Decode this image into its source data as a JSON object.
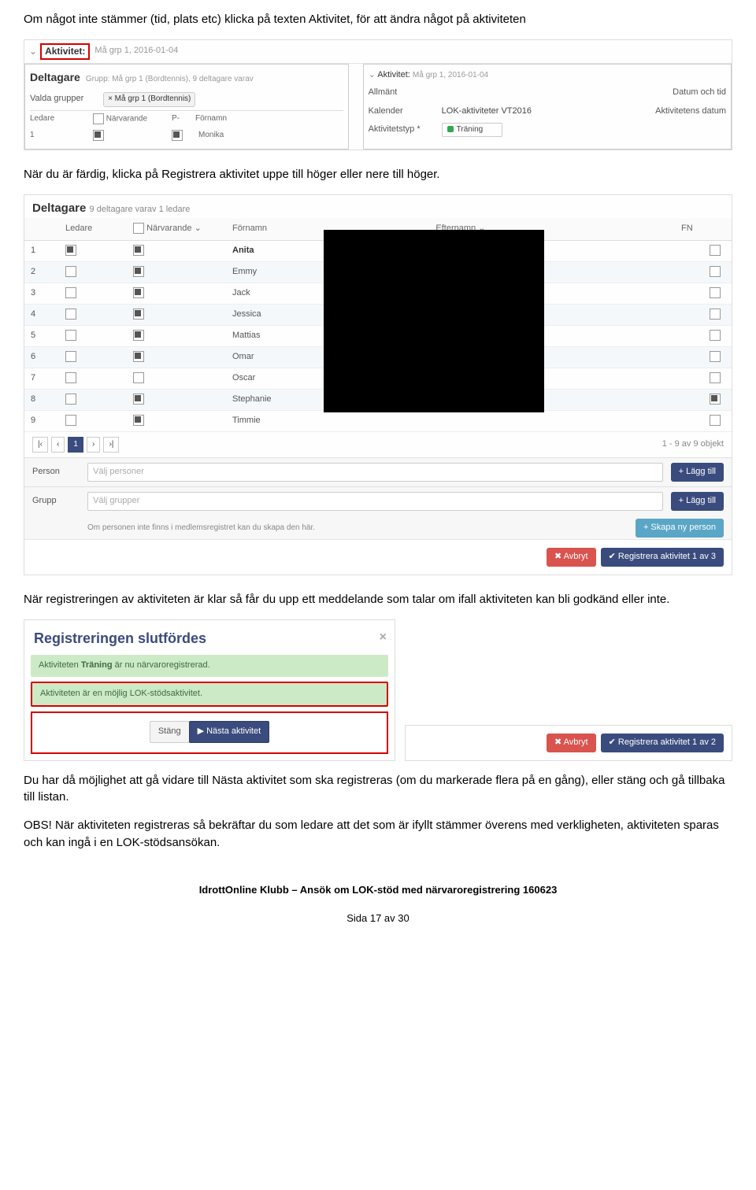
{
  "para1": "Om något inte stämmer (tid, plats etc) klicka på texten Aktivitet, för att ändra något på aktiviteten",
  "para2": "När du är färdig, klicka på Registrera aktivitet uppe till höger eller nere till höger.",
  "para3": "När registreringen av aktiviteten är klar så får du upp ett meddelande som talar om ifall aktiviteten kan bli godkänd eller inte.",
  "para4": "Du har då möjlighet att gå vidare till Nästa aktivitet som ska registreras (om du markerade flera på en gång), eller stäng och gå tillbaka till listan.",
  "para5": "OBS! När aktiviteten registreras så bekräftar du som ledare att det som är ifyllt stämmer överens med verkligheten, aktiviteten sparas och kan ingå i en LOK-stödsansökan.",
  "footer_line": "IdrottOnline Klubb – Ansök om LOK-stöd med närvaroregistrering 160623",
  "page_num": "Sida 17 av 30",
  "s1": {
    "aktivitet_label": "Aktivitet:",
    "aktivitet_sub": "Må grp 1, 2016-01-04",
    "deltagare_title": "Deltagare",
    "deltagare_group": "Grupp: Må grp 1 (Bordtennis), 9 deltagare varav",
    "valda_grupper": "Valda grupper",
    "grupp_tag": "× Må grp 1 (Bordtennis)",
    "th_ledare": "Ledare",
    "th_narv": "Närvarande",
    "th_p": "P-",
    "th_fornamn": "Förnamn",
    "row1_num": "1",
    "row1_name": "Monika",
    "right_aktivitet_label": "Aktivitet:",
    "right_aktivitet_sub": "Må grp 1, 2016-01-04",
    "allmant": "Allmänt",
    "datum_tid": "Datum och tid",
    "kalender_lbl": "Kalender",
    "kalender_val": "LOK-aktiviteter VT2016",
    "akttyp_lbl": "Aktivitetstyp *",
    "akttyp_val": "Träning",
    "aktdat_lbl": "Aktivitetens datum"
  },
  "s2": {
    "title": "Deltagare",
    "subtitle": "9 deltagare varav 1 ledare",
    "cols": {
      "ledare": "Ledare",
      "narv": "Närvarande",
      "fn": "Förnamn",
      "en": "Efternamn",
      "fncol": "FN"
    },
    "rows": [
      {
        "n": "1",
        "led": true,
        "nar": true,
        "name": "Anita",
        "fn": false,
        "even": false
      },
      {
        "n": "2",
        "led": false,
        "nar": true,
        "name": "Emmy",
        "fn": false,
        "even": true
      },
      {
        "n": "3",
        "led": false,
        "nar": true,
        "name": "Jack",
        "fn": false,
        "even": false
      },
      {
        "n": "4",
        "led": false,
        "nar": true,
        "name": "Jessica",
        "fn": false,
        "even": true
      },
      {
        "n": "5",
        "led": false,
        "nar": true,
        "name": "Mattias",
        "fn": false,
        "even": false
      },
      {
        "n": "6",
        "led": false,
        "nar": true,
        "name": "Omar",
        "fn": false,
        "even": true
      },
      {
        "n": "7",
        "led": false,
        "nar": false,
        "name": "Oscar",
        "fn": false,
        "even": false
      },
      {
        "n": "8",
        "led": false,
        "nar": true,
        "name": "Stephanie",
        "fn": true,
        "even": true
      },
      {
        "n": "9",
        "led": false,
        "nar": true,
        "name": "Timmie",
        "fn": false,
        "even": false
      }
    ],
    "pager_status": "1 - 9 av 9 objekt",
    "pager_first": "|‹",
    "pager_prev": "‹",
    "pager_page": "1",
    "pager_next": "›",
    "pager_last": "›|",
    "person_lbl": "Person",
    "person_ph": "Välj personer",
    "grupp_lbl": "Grupp",
    "grupp_ph": "Välj grupper",
    "add_label": "+ Lägg till",
    "skapa_label": "+ Skapa ny person",
    "note": "Om personen inte finns i medlemsregistret kan du skapa den här.",
    "avbryt": "✖ Avbryt",
    "registrera": "✔ Registrera aktivitet 1 av 3"
  },
  "s3": {
    "modal_title": "Registreringen slutfördes",
    "line1_a": "Aktiviteten ",
    "line1_b": "Träning",
    "line1_c": " är nu närvaroregistrerad.",
    "line2": "Aktiviteten är en möjlig LOK-stödsaktivitet.",
    "btn_stang": "Stäng",
    "btn_nasta": "▶ Nästa aktivitet",
    "side_avbryt": "✖ Avbryt",
    "side_reg": "✔ Registrera aktivitet 1 av 2"
  }
}
